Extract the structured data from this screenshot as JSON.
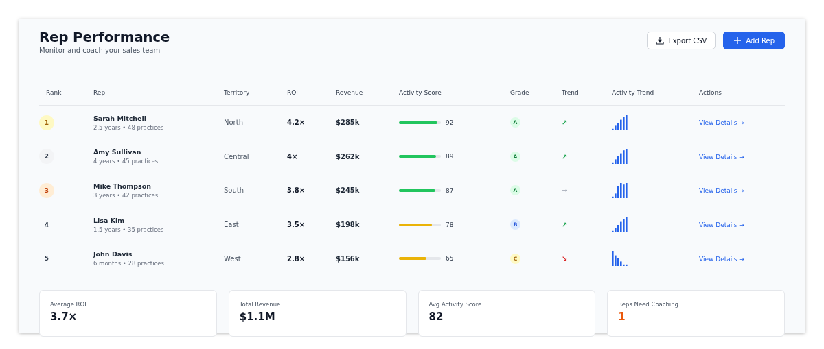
{
  "header": {
    "title": "Rep Performance",
    "subtitle": "Monitor and coach your sales team"
  },
  "buttons": [
    {
      "label": "Export CSV",
      "kind": "secondary"
    },
    {
      "label": "Add Rep",
      "kind": "primary"
    }
  ],
  "table": {
    "columns": [
      "Rank",
      "Rep",
      "Territory",
      "ROI",
      "Revenue",
      "Activity Score",
      "Grade",
      "Trend",
      "Activity Trend",
      "Actions"
    ],
    "rows": [
      {
        "rank": "1",
        "kind": "gold",
        "name": "Sarah Mitchell",
        "meta": "2.5 years • 48 practices",
        "territory": "North",
        "roi": "4.2×",
        "revenue": "$285k",
        "level": 0.92,
        "color": "#22c55e",
        "score": "92",
        "grade": "A",
        "trend": {
          "symbol": "↗",
          "kind": "up"
        },
        "sparkline": {
          "kind": "rising"
        },
        "action": "View Details →"
      },
      {
        "rank": "2",
        "kind": "silver",
        "name": "Amy Sullivan",
        "meta": "4 years • 45 practices",
        "territory": "Central",
        "roi": "4×",
        "revenue": "$262k",
        "level": 0.89,
        "color": "#22c55e",
        "score": "89",
        "grade": "A",
        "trend": {
          "symbol": "↗",
          "kind": "up"
        },
        "sparkline": {
          "kind": "rising"
        },
        "action": "View Details →"
      },
      {
        "rank": "3",
        "kind": "bronze",
        "name": "Mike Thompson",
        "meta": "3 years • 42 practices",
        "territory": "South",
        "roi": "3.8×",
        "revenue": "$245k",
        "level": 0.87,
        "color": "#22c55e",
        "score": "87",
        "grade": "A",
        "trend": {
          "symbol": "→",
          "kind": "flat"
        },
        "sparkline": {
          "kind": "peaked"
        },
        "action": "View Details →"
      },
      {
        "rank": "4",
        "kind": "plain",
        "name": "Lisa Kim",
        "meta": "1.5 years • 35 practices",
        "territory": "East",
        "roi": "3.5×",
        "revenue": "$198k",
        "level": 0.78,
        "color": "#eab308",
        "score": "78",
        "grade": "B",
        "trend": {
          "symbol": "↗",
          "kind": "up"
        },
        "sparkline": {
          "kind": "rising"
        },
        "action": "View Details →"
      },
      {
        "rank": "5",
        "kind": "plain",
        "name": "John Davis",
        "meta": "6 months • 28 practices",
        "territory": "West",
        "roi": "2.8×",
        "revenue": "$156k",
        "level": 0.65,
        "color": "#eab308",
        "score": "65",
        "grade": "C",
        "trend": {
          "symbol": "↘",
          "kind": "down"
        },
        "sparkline": {
          "kind": "falling"
        },
        "action": "View Details →"
      }
    ]
  },
  "stats": [
    {
      "label": "Average ROI",
      "value": "3.7×",
      "alert": false
    },
    {
      "label": "Total Revenue",
      "value": "$1.1M",
      "alert": false
    },
    {
      "label": "Avg Activity Score",
      "value": "82",
      "alert": false
    },
    {
      "label": "Reps Need Coaching",
      "value": "1",
      "alert": true
    }
  ]
}
